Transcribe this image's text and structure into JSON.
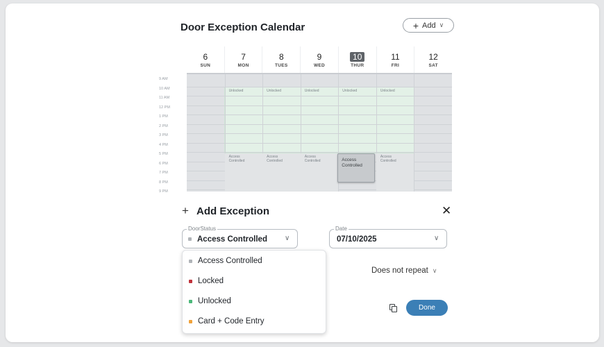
{
  "header": {
    "title": "Door Exception Calendar",
    "add_button": {
      "icon": "+",
      "label": "Add",
      "chevron": "∨"
    }
  },
  "calendar": {
    "days": [
      {
        "num": "6",
        "name": "SUN"
      },
      {
        "num": "7",
        "name": "MON"
      },
      {
        "num": "8",
        "name": "TUES"
      },
      {
        "num": "9",
        "name": "WED"
      },
      {
        "num": "10",
        "name": "THUR",
        "today": true
      },
      {
        "num": "11",
        "name": "FRI"
      },
      {
        "num": "12",
        "name": "SAT"
      }
    ],
    "hours": [
      "9 AM",
      "10 AM",
      "11 AM",
      "12 PM",
      "1 PM",
      "2 PM",
      "3 PM",
      "4 PM",
      "5 PM",
      "6 PM",
      "7 PM",
      "8 PM",
      "9 PM"
    ],
    "unlocked_label": "Unlocked",
    "access_label_line1": "Access",
    "access_label_line2": "Controlled",
    "selected_event": {
      "line1": "Access",
      "line2": "Controlled"
    },
    "colors": {
      "unlocked": "#e3f1e7",
      "grid": "#dfe1e4",
      "selected": "#c7cacd"
    }
  },
  "form": {
    "title": "Add Exception",
    "door_status": {
      "label": "DoorStatus",
      "value": "Access Controlled",
      "dot_color": "#b0b4b8"
    },
    "date": {
      "label": "Date",
      "value": "07/10/2025"
    },
    "repeat": {
      "value": "Does not repeat"
    },
    "done_label": "Done"
  },
  "dropdown": {
    "options": [
      {
        "label": "Access Controlled",
        "color": "#b0b4b8"
      },
      {
        "label": "Locked",
        "color": "#c0333b"
      },
      {
        "label": "Unlocked",
        "color": "#4cb87a"
      },
      {
        "label": "Card + Code Entry",
        "color": "#f0a23a"
      }
    ]
  }
}
